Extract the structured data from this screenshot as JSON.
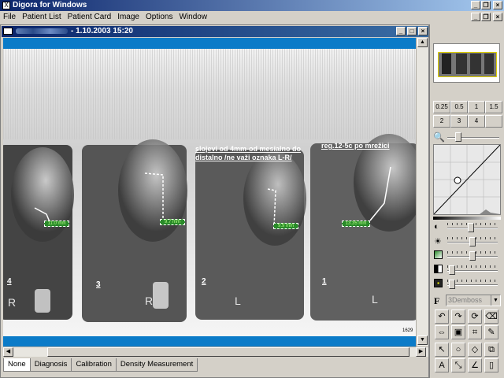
{
  "app": {
    "title": "Digora for Windows"
  },
  "menu": {
    "items": [
      "File",
      "Patient List",
      "Patient Card",
      "Image",
      "Options",
      "Window"
    ]
  },
  "child_window": {
    "title": "- 1.10.2003 15:20"
  },
  "films": [
    {
      "number": "4",
      "side": "R",
      "measurement": "11.0 mm"
    },
    {
      "number": "3",
      "side": "R",
      "measurement": "9.7 mm"
    },
    {
      "number": "2",
      "side": "L",
      "measurement": "9.9 mm"
    },
    {
      "number": "1",
      "side": "L",
      "measurement": "13.35 mm"
    }
  ],
  "annotations": {
    "middle": "slojevi od 4mm-od mesialno do distalno /ne važi oznaka L-R/",
    "right": "reg.12-5c po mrežici"
  },
  "corner_id": "1629",
  "tabs": [
    "None",
    "Diagnosis",
    "Calibration",
    "Density Measurement"
  ],
  "active_tab": "None",
  "zoom_buttons": [
    "0.25",
    "0.5",
    "1",
    "1.5",
    "2",
    "3",
    "4",
    ""
  ],
  "emboss_select": "3Demboss",
  "font_icon_label": "F"
}
